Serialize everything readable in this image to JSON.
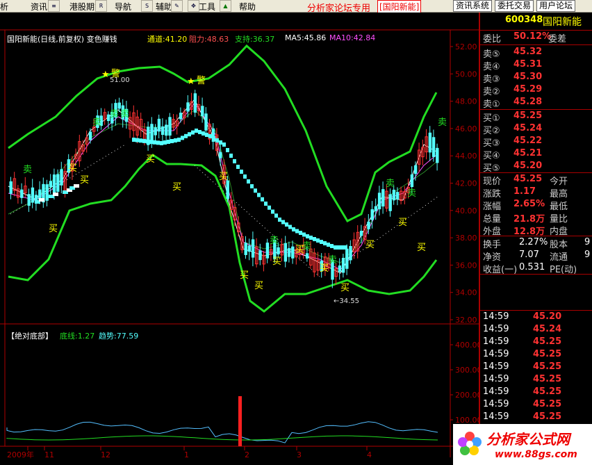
{
  "menu": {
    "items": [
      "析",
      "资讯",
      "港股期货",
      "导航",
      "辅助",
      "工具",
      "帮助"
    ],
    "forum_label": "分析家论坛专用",
    "stock_tag": "[国阳新能]",
    "right_buttons": [
      "资讯系统",
      "委托交易",
      "用户论坛"
    ]
  },
  "chart_header": {
    "title": "国阳新能(日线,前复权) 变色赚钱",
    "tongdao": "通道:41.20",
    "zuli": "阻力:48.63",
    "zhichi": "支持:36.37",
    "ma5": "MA5:45.86",
    "ma10": "MA10:42.84"
  },
  "indicator_header": {
    "name": "【绝对底部】",
    "dixian": "底线:1.27",
    "qushi": "趋势:77.59"
  },
  "y_axis_main": [
    "52.00",
    "50.00",
    "48.00",
    "46.00",
    "44.00",
    "42.00",
    "40.00",
    "38.00",
    "36.00",
    "34.00",
    "32.00"
  ],
  "y_axis_ind": [
    "400.00",
    "300.00",
    "200.00",
    "100.00"
  ],
  "x_axis": [
    "2009年",
    "11",
    "12",
    "1",
    "2",
    "3",
    "4"
  ],
  "annotations": {
    "high_label": "51.00",
    "low_label": "34.55",
    "buy": "买",
    "sell": "卖",
    "warn": "警"
  },
  "quote": {
    "code": "600348",
    "name": "国阳新能",
    "weibi_label": "委比",
    "weibi": "50.12%",
    "weicha_label": "委差",
    "sell": [
      {
        "label": "卖⑤",
        "price": "45.32"
      },
      {
        "label": "卖④",
        "price": "45.31"
      },
      {
        "label": "卖③",
        "price": "45.30"
      },
      {
        "label": "卖②",
        "price": "45.29"
      },
      {
        "label": "卖①",
        "price": "45.28"
      }
    ],
    "buy": [
      {
        "label": "买①",
        "price": "45.25"
      },
      {
        "label": "买②",
        "price": "45.24"
      },
      {
        "label": "买③",
        "price": "45.22"
      },
      {
        "label": "买④",
        "price": "45.21"
      },
      {
        "label": "买⑤",
        "price": "45.20"
      }
    ],
    "stats": [
      {
        "l1": "现价",
        "v1": "45.25",
        "l2": "今开"
      },
      {
        "l1": "涨跌",
        "v1": "1.17",
        "l2": "最高"
      },
      {
        "l1": "涨幅",
        "v1": "2.65%",
        "l2": "最低"
      },
      {
        "l1": "总量",
        "v1": "21.8万",
        "l2": "量比"
      },
      {
        "l1": "外盘",
        "v1": "12.8万",
        "l2": "内盘"
      }
    ],
    "stats2": [
      {
        "l1": "换手",
        "v1": "2.27%",
        "l2": "股本",
        "v2": "9"
      },
      {
        "l1": "净资",
        "v1": "7.07",
        "l2": "流通",
        "v2": "9"
      },
      {
        "l1": "收益(一)",
        "v1": "0.531",
        "l2": "PE(动)",
        "v2": ""
      }
    ],
    "ticks": [
      {
        "time": "14:59",
        "price": "45.20"
      },
      {
        "time": "14:59",
        "price": "45.24"
      },
      {
        "time": "14:59",
        "price": "45.25"
      },
      {
        "time": "14:59",
        "price": "45.25"
      },
      {
        "time": "14:59",
        "price": "45.25"
      },
      {
        "time": "14:59",
        "price": "45.25"
      },
      {
        "time": "14:59",
        "price": "45.25"
      },
      {
        "time": "14:59",
        "price": "45.25"
      },
      {
        "time": "14:59",
        "price": "45.25"
      },
      {
        "time": "14:59",
        "price": "45.25"
      }
    ]
  },
  "watermark": {
    "text": "分析家公式网",
    "url": "www.88gs.com"
  },
  "colors": {
    "up": "#ff3232",
    "down": "#54ffff",
    "band": "#22dd22",
    "yellow": "#ffff00",
    "axis_red": "#b00000"
  }
}
